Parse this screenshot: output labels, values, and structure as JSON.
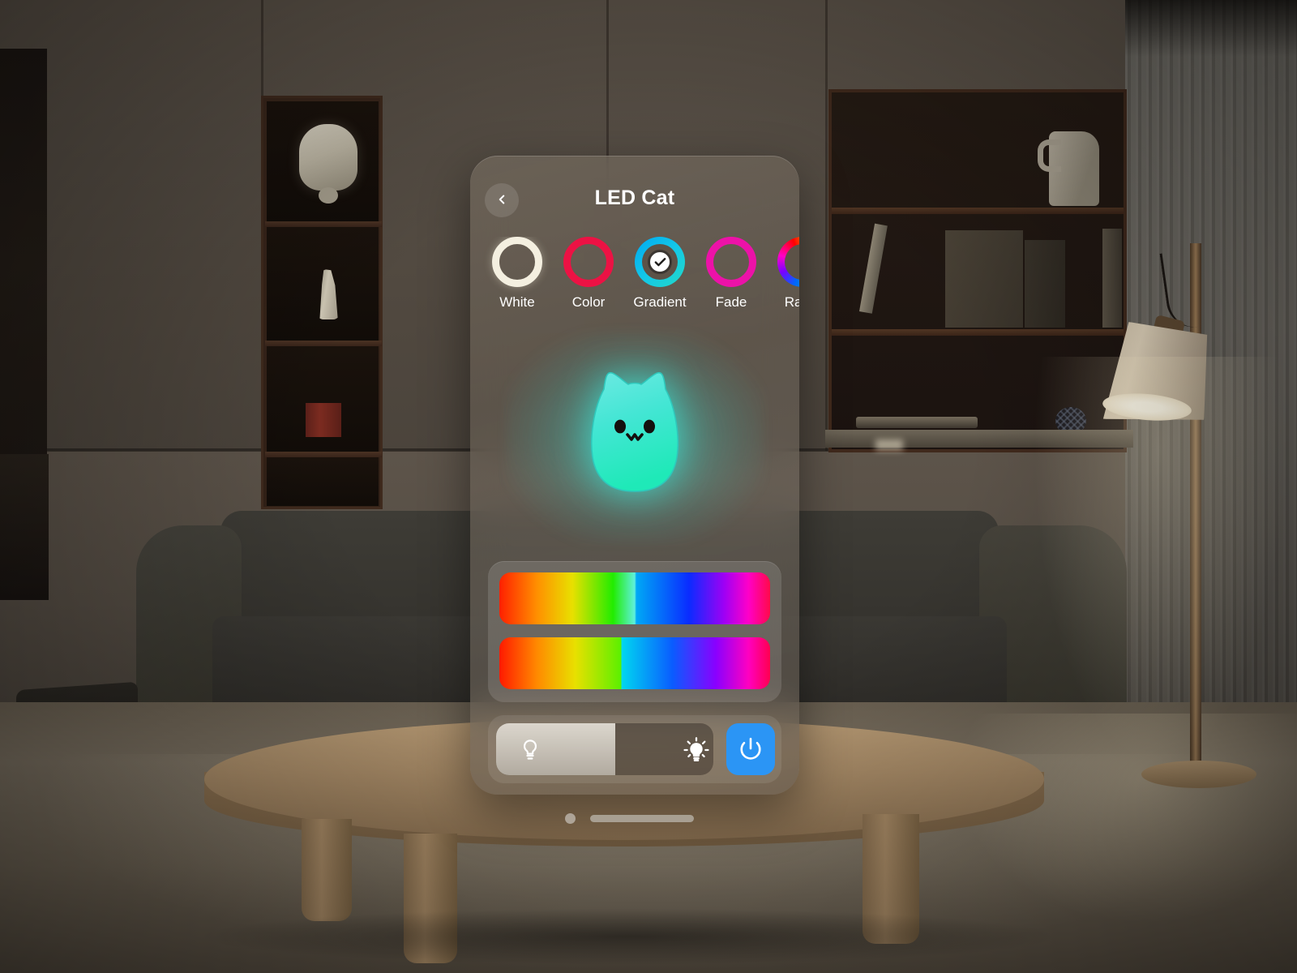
{
  "app": {
    "title": "LED Cat",
    "back_icon": "chevron-left-icon"
  },
  "modes": {
    "selected": "Gradient",
    "items": [
      {
        "label": "White",
        "ring_color": "#f4efe0",
        "icon": "white-ring-icon",
        "selected": false
      },
      {
        "label": "Color",
        "ring_color": "#ec1244",
        "icon": "color-ring-icon",
        "selected": false
      },
      {
        "label": "Gradient",
        "ring_color": "#13c8e8",
        "icon": "gradient-ring-icon",
        "selected": true
      },
      {
        "label": "Fade",
        "ring_color": "#ec12a8",
        "icon": "fade-ring-icon",
        "selected": false
      },
      {
        "label": "Rainb",
        "ring_color": "#00cc66",
        "icon": "rainbow-ring-icon",
        "selected": false
      }
    ]
  },
  "preview": {
    "device_icon": "cat-night-light-icon",
    "glow_color": "#3de8d0",
    "body_top_color": "#63e6e0",
    "body_bottom_color": "#2ae8bd"
  },
  "color_sliders": [
    {
      "name": "gradient-slider-1",
      "seam_percent": 50,
      "value_percent": 50
    },
    {
      "name": "gradient-slider-2",
      "seam_percent": 42,
      "value_percent": 42
    }
  ],
  "controls": {
    "brightness": {
      "value_percent": 55,
      "low_icon": "bulb-outline-icon",
      "high_icon": "bulb-bright-icon"
    },
    "power": {
      "icon": "power-icon",
      "color": "#2b95f5",
      "state": "on"
    }
  },
  "system": {
    "page_indicator_icon": "page-dot-icon",
    "home_indicator_icon": "home-bar-icon"
  }
}
